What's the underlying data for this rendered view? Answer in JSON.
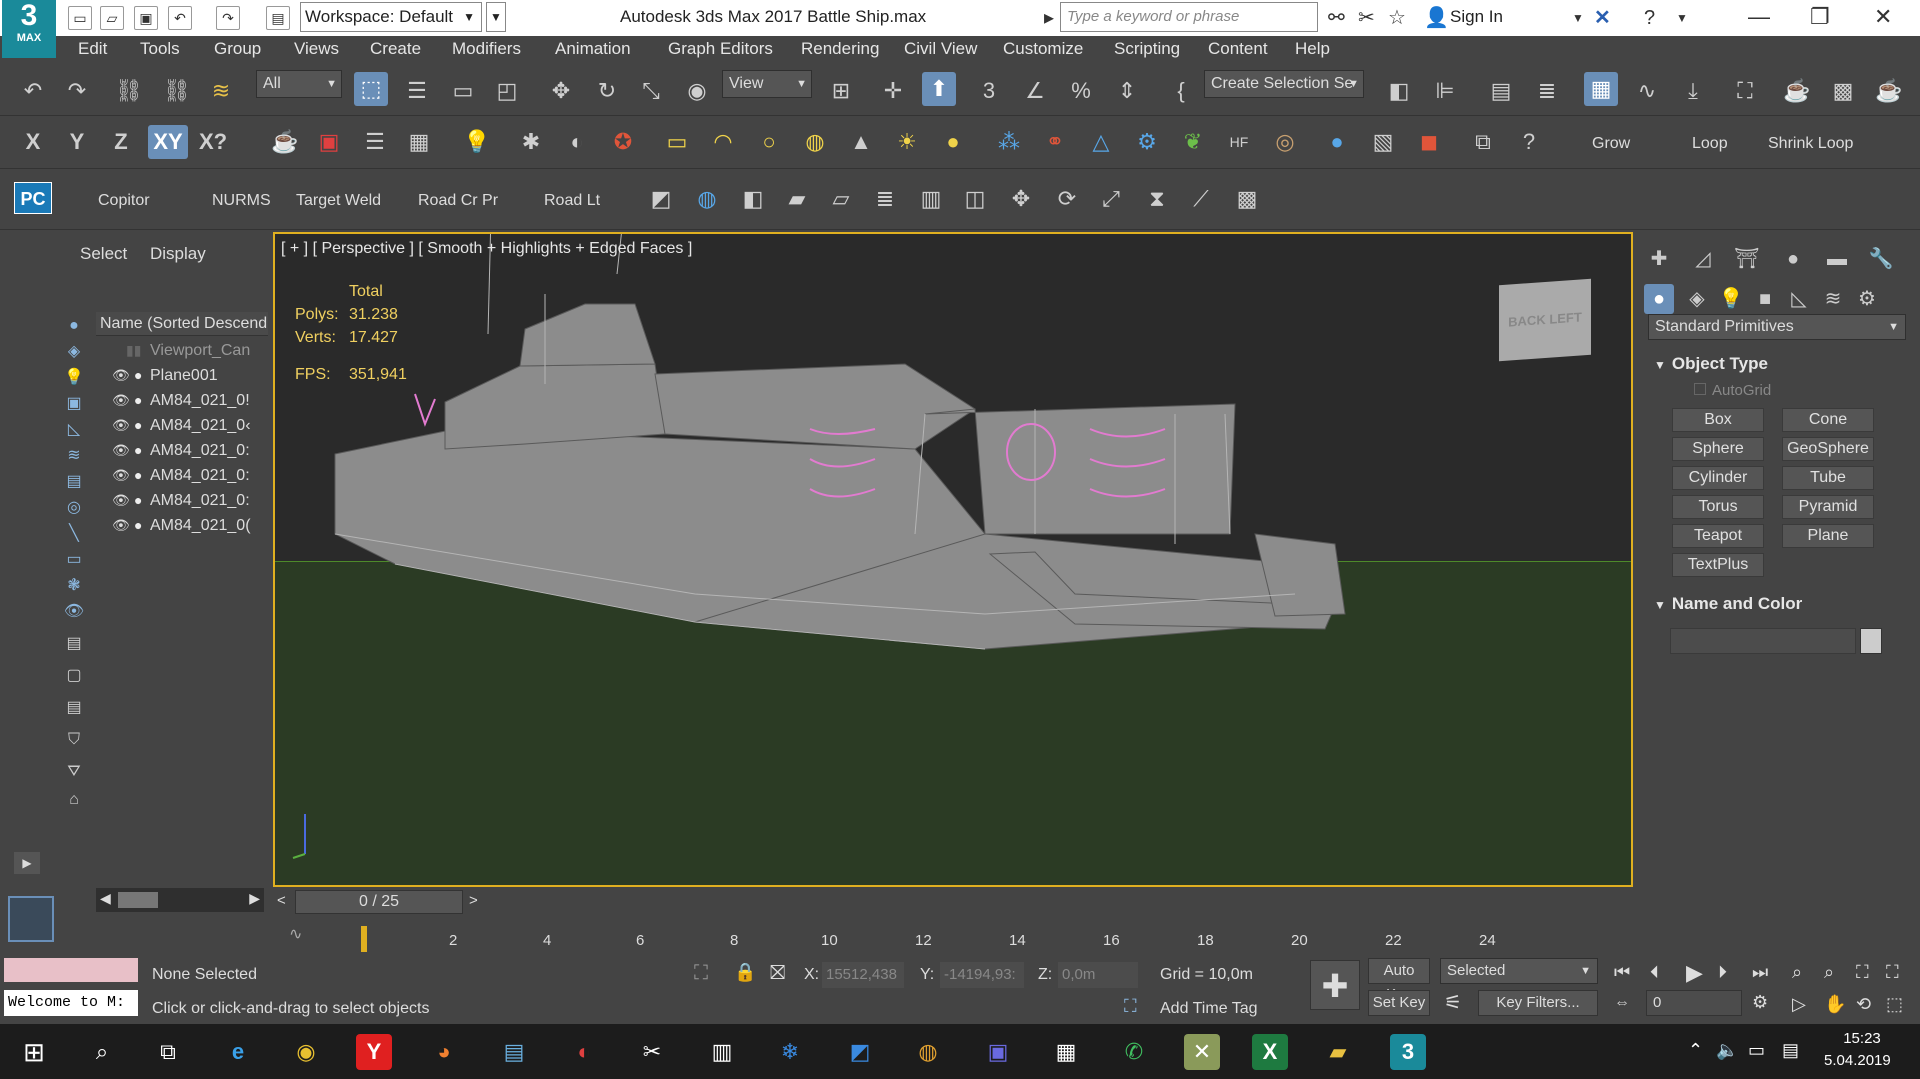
{
  "titlebar": {
    "logo_number": "3",
    "logo_text": "MAX",
    "workspace": "Workspace: Default",
    "window_title": "Autodesk 3ds Max 2017    Battle Ship.max",
    "search_placeholder": "Type a keyword or phrase",
    "sign_in": "Sign In"
  },
  "menu": [
    "Edit",
    "Tools",
    "Group",
    "Views",
    "Create",
    "Modifiers",
    "Animation",
    "Graph Editors",
    "Rendering",
    "Civil View",
    "Customize",
    "Scripting",
    "Content",
    "Help"
  ],
  "toolbar1": {
    "filter_value": "All",
    "refcoord_value": "View",
    "selection_set_placeholder": "Create Selection Se"
  },
  "toolbar2": {
    "axis": [
      "X",
      "Y",
      "Z",
      "XY",
      "X?"
    ],
    "grow": "Grow",
    "loop": "Loop",
    "shrink_loop": "Shrink Loop"
  },
  "toolbar3": {
    "pc_badge": "PC",
    "buttons": [
      "Copitor",
      "NURMS",
      "Target Weld",
      "Road Cr Pr",
      "Road Lt"
    ]
  },
  "explorer": {
    "tabs": [
      "Select",
      "Display"
    ],
    "column_header": "Name (Sorted Descendin",
    "items": [
      "Viewport_Can",
      "Plane001",
      "AM84_021_0!",
      "AM84_021_0‹",
      "AM84_021_0:",
      "AM84_021_0:",
      "AM84_021_0:",
      "AM84_021_0("
    ]
  },
  "viewport": {
    "label": "[ + ] [ Perspective ] [ Smooth + Highlights + Edged Faces ]",
    "stats_total": "Total",
    "polys_label": "Polys:",
    "polys_value": "31.238",
    "verts_label": "Verts:",
    "verts_value": "17.427",
    "fps_label": "FPS:",
    "fps_value": "351,941",
    "viewcube_text": "BACK   LEFT",
    "ground_color": "#2b3b24",
    "background_color": "#2a2a2a",
    "border_color": "#e0b020"
  },
  "command_panel": {
    "category": "Standard Primitives",
    "object_type_title": "Object Type",
    "autogrid": "AutoGrid",
    "primitives": [
      "Box",
      "Cone",
      "Sphere",
      "GeoSphere",
      "Cylinder",
      "Tube",
      "Torus",
      "Pyramid",
      "Teapot",
      "Plane",
      "TextPlus"
    ],
    "name_color_title": "Name and Color"
  },
  "timeline": {
    "frame_display": "0 / 25",
    "ticks": [
      "2",
      "4",
      "6",
      "8",
      "10",
      "12",
      "14",
      "16",
      "18",
      "20",
      "22",
      "24"
    ]
  },
  "status": {
    "maxscript": "Welcome to M:",
    "selection": "None Selected",
    "prompt": "Click or click-and-drag to select objects",
    "x_label": "X:",
    "x_value": "15512,438",
    "y_label": "Y:",
    "y_value": "-14194,93:",
    "z_label": "Z:",
    "z_value": "0,0m",
    "grid": "Grid = 10,0m",
    "add_time_tag": "Add Time Tag",
    "auto_key": "Auto Key",
    "set_key": "Set Key",
    "key_mode": "Selected",
    "key_filters": "Key Filters...",
    "frame_value": "0"
  },
  "taskbar": {
    "time": "15:23",
    "date": "5.04.2019"
  }
}
